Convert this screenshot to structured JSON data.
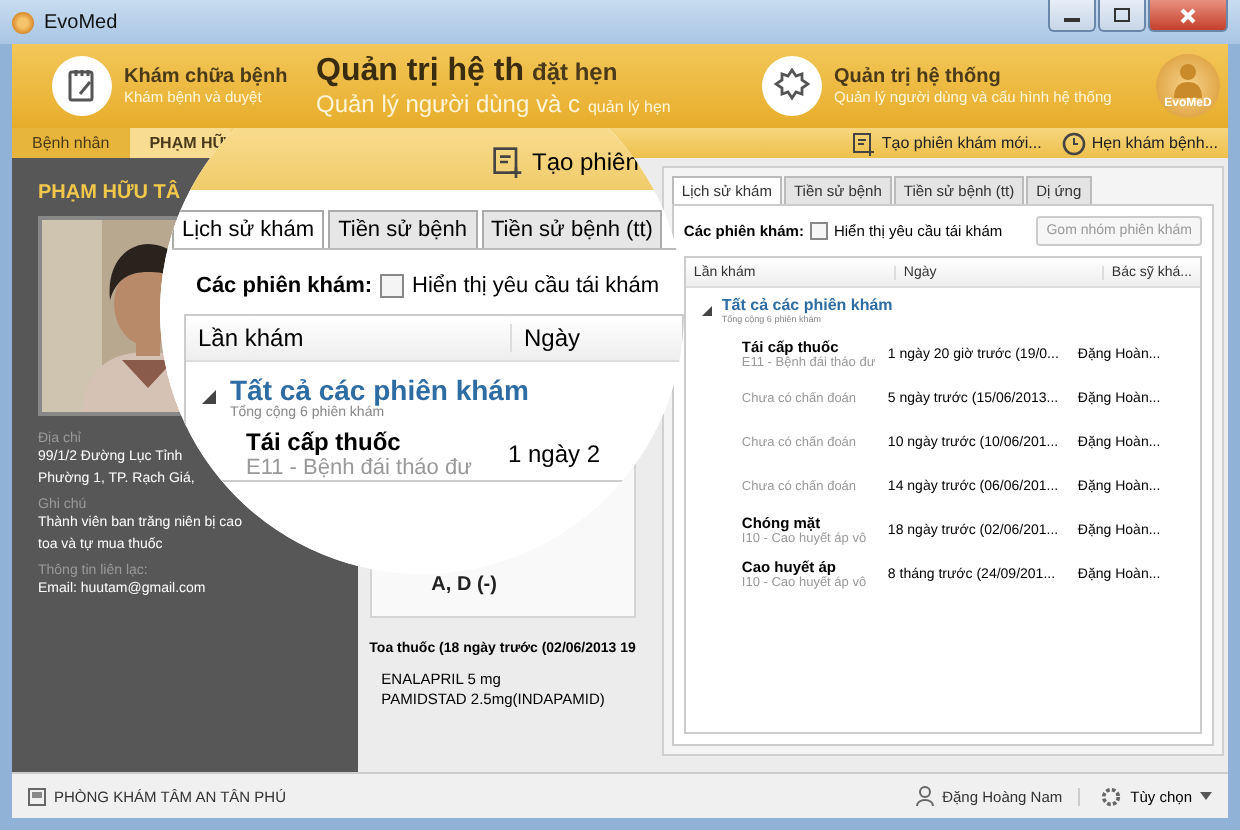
{
  "window": {
    "title": "EvoMed"
  },
  "modules": [
    {
      "title": "Khám chữa bệnh",
      "subtitle": "Khám bệnh và duyệt"
    },
    {
      "title": "đặt hẹn",
      "subtitle": "quản lý hẹn"
    },
    {
      "title": "Quản trị hệ thống",
      "subtitle": "Quản lý người dùng và cấu hình hệ thống"
    }
  ],
  "logo": {
    "text": "EvoMeD"
  },
  "breadcrumb": [
    {
      "label": "Bệnh nhân",
      "selected": false
    },
    {
      "label": "PHẠM HỮ",
      "selected": true
    }
  ],
  "actions": [
    {
      "label": "Tạo phiên khám mới..."
    },
    {
      "label": "Hẹn khám bệnh..."
    }
  ],
  "patient": {
    "name": "PHẠM HỮU TÂ",
    "fields": [
      {
        "label": "Địa chỉ",
        "lines": [
          "99/1/2 Đường Lục Tỉnh",
          "Phường 1, TP. Rạch Giá,"
        ]
      },
      {
        "label": "Ghi chú",
        "lines": [
          "Thành viên ban trăng niên bị cao",
          "toa và tự mua thuốc"
        ]
      },
      {
        "label": "Thông tin liên lạc:",
        "lines": [
          "Email: huutam@gmail.com"
        ]
      }
    ]
  },
  "visit_detail": {
    "diagnosis": "A, D (-)",
    "prescription_title": "Toa thuốc (18 ngày trước (02/06/2013 19",
    "medicines": [
      "ENALAPRIL 5 mg",
      "PAMIDSTAD 2.5mg(INDAPAMID)"
    ]
  },
  "history": {
    "tabs": [
      {
        "label": "Lịch sử khám",
        "selected": true
      },
      {
        "label": "Tiền sử bệnh",
        "selected": false
      },
      {
        "label": "Tiền sử bệnh (tt)",
        "selected": false
      },
      {
        "label": "Dị ứng",
        "selected": false
      }
    ],
    "filter_label": "Các phiên khám:",
    "checkbox": {
      "label": "Hiển thị yêu cầu tái khám",
      "checked": false
    },
    "group_button": {
      "label": "Gom nhóm phiên khám",
      "disabled": true
    },
    "columns": [
      "Lần khám",
      "Ngày",
      "Bác sỹ khá..."
    ],
    "group": {
      "title": "Tất cả các phiên khám",
      "subtitle": "Tổng cộng 6 phiên khám",
      "expanded": true
    },
    "rows": [
      {
        "title": "Tái cấp thuốc",
        "subtitle": "E11 - Bệnh đái tháo đư",
        "date": "1 ngày 20 giờ trước (19/0...",
        "doctor": "Đặng Hoàn..."
      },
      {
        "subtitle": "Chưa có chẩn đoán",
        "date": "5 ngày trước (15/06/2013...",
        "doctor": "Đặng Hoàn..."
      },
      {
        "subtitle": "Chưa có chẩn đoán",
        "date": "10 ngày trước (10/06/201...",
        "doctor": "Đặng Hoàn..."
      },
      {
        "subtitle": "Chưa có chẩn đoán",
        "date": "14 ngày trước (06/06/201...",
        "doctor": "Đặng Hoàn..."
      },
      {
        "title": "Chóng mặt",
        "subtitle": "I10 - Cao huyết áp vô",
        "date": "18 ngày trước (02/06/201...",
        "doctor": "Đặng Hoàn..."
      },
      {
        "title": "Cao huyết áp",
        "subtitle": "I10 - Cao huyết áp vô",
        "date": "8 tháng trước (24/09/201...",
        "doctor": "Đặng Hoàn..."
      }
    ]
  },
  "magnifier": {
    "module_title": "Quản trị hệ th",
    "module_subtitle": "Quản lý người dùng và c",
    "toolbar_action": "Tạo phiên",
    "tabs": [
      {
        "label": "Lịch sử khám",
        "selected": true
      },
      {
        "label": "Tiền sử bệnh",
        "selected": false
      },
      {
        "label": "Tiền sử bệnh (tt)",
        "selected": false
      }
    ],
    "filter_label": "Các phiên khám:",
    "checkbox": {
      "label": "Hiển thị yêu cầu tái khám",
      "checked": false
    },
    "columns": [
      "Lần khám",
      "Ngày"
    ],
    "group": {
      "title": "Tất cả các phiên khám",
      "subtitle": "Tổng cộng 6 phiên khám",
      "expanded": true
    },
    "row": {
      "title": "Tái cấp thuốc",
      "subtitle": "E11 - Bệnh đái tháo đư",
      "date": "1 ngày 2"
    }
  },
  "status_bar": {
    "clinic": "PHÒNG KHÁM TÂM AN TÂN PHÚ",
    "user": "Đặng Hoàng Nam",
    "options": "Tùy chọn"
  }
}
